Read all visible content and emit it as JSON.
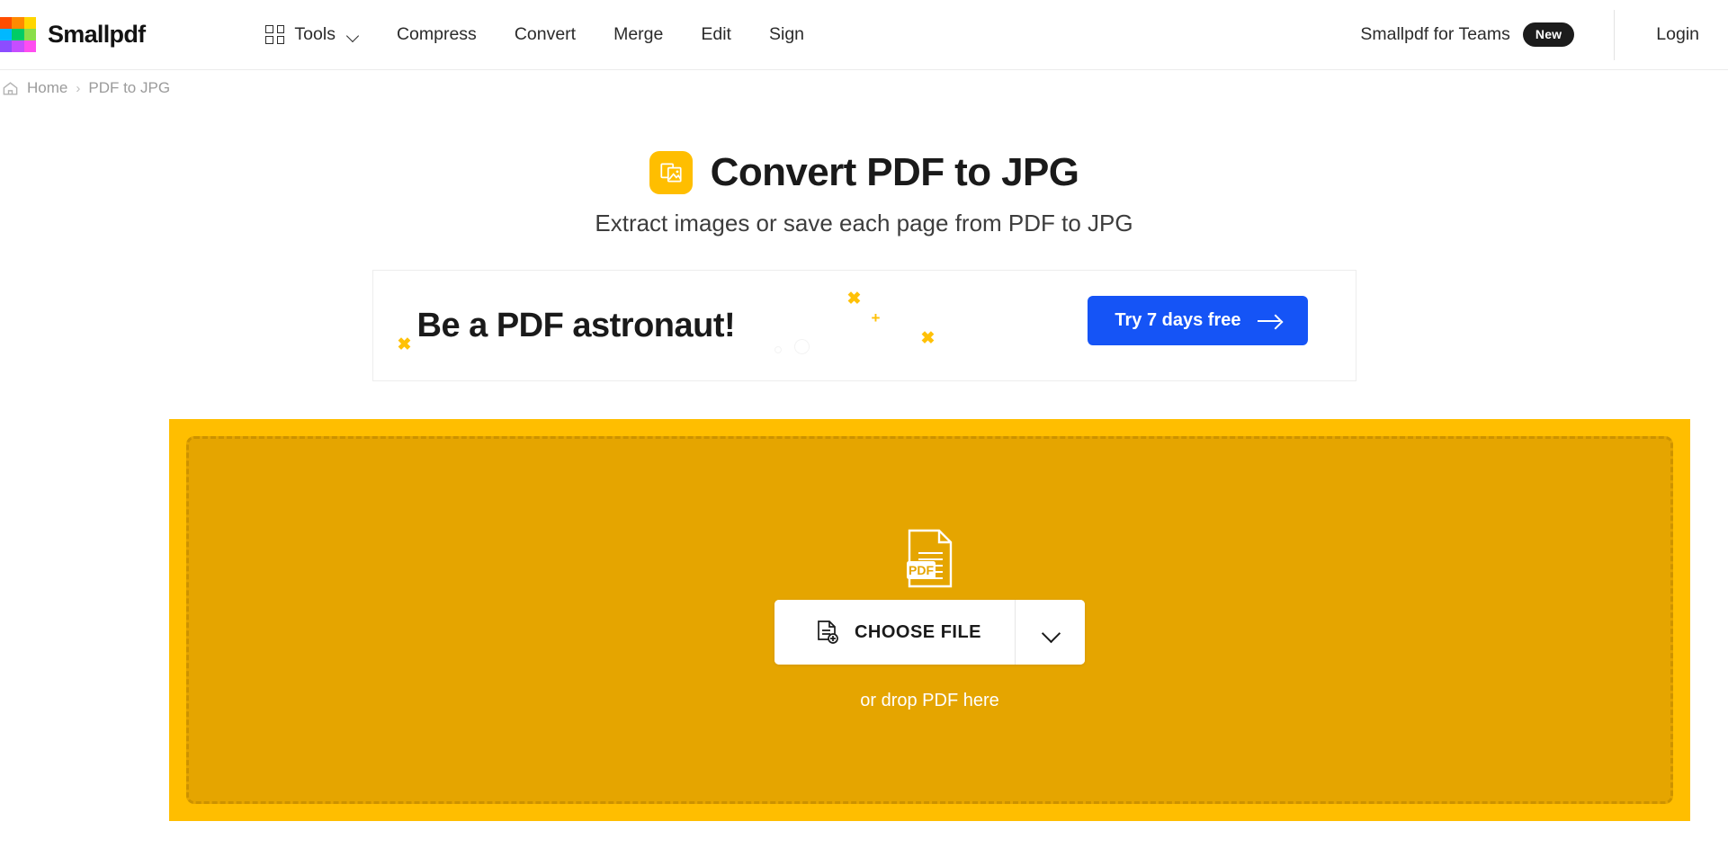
{
  "brand": {
    "name": "Smallpdf",
    "logo_icon": "smallpdf-grid-logo",
    "logo_colors": [
      "#ff4d00",
      "#ff8a00",
      "#ffd600",
      "#00b8ff",
      "#00cc66",
      "#8ade4a",
      "#8c4dff",
      "#c64dff",
      "#ff4df0"
    ]
  },
  "nav": {
    "tools_label": "Tools",
    "tools_icon": "grid-icon",
    "tools_chevron": "chevron-down-icon",
    "links": [
      {
        "label": "Compress"
      },
      {
        "label": "Convert"
      },
      {
        "label": "Merge"
      },
      {
        "label": "Edit"
      },
      {
        "label": "Sign"
      }
    ],
    "teams_label": "Smallpdf for Teams",
    "teams_badge": "New",
    "login_label": "Login"
  },
  "breadcrumb": {
    "home_icon": "home-icon",
    "home_label": "Home",
    "separator": "›",
    "current_label": "PDF to JPG"
  },
  "hero": {
    "icon": "pdf-to-jpg-icon",
    "icon_color": "#ffbe00",
    "title": "Convert PDF to JPG",
    "subtitle": "Extract images or save each page from PDF to JPG"
  },
  "promo": {
    "headline": "Be a PDF astronaut!",
    "cta_label": "Try 7 days free",
    "cta_arrow_icon": "arrow-right-icon",
    "cta_color": "#1554f6",
    "sparkle_color": "#ffc107",
    "sparkles": [
      "✖",
      "+",
      "✖",
      "✖",
      "✖"
    ]
  },
  "dropzone": {
    "outer_color": "#ffbe00",
    "inner_color": "#e5a500",
    "border_color": "#cc9200",
    "file_icon": "pdf-file-icon",
    "file_icon_label": "PDF",
    "choose_icon": "document-add-icon",
    "choose_label": "CHOOSE FILE",
    "dropdown_icon": "chevron-down-icon",
    "drop_hint": "or drop PDF here"
  }
}
